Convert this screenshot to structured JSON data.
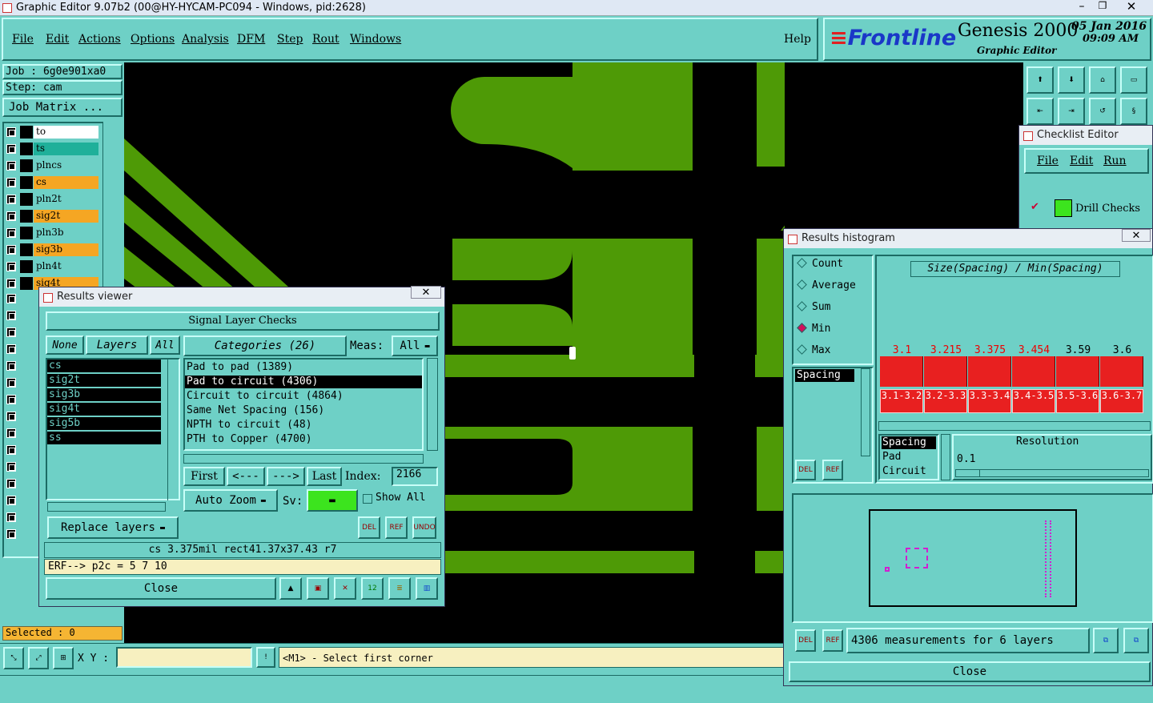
{
  "window_title": "Graphic Editor 9.07b2 (00@HY-HYCAM-PC094 - Windows, pid:2628)",
  "menu": [
    "File",
    "Edit",
    "Actions",
    "Options",
    "Analysis",
    "DFM",
    "Step",
    "Rout",
    "Windows"
  ],
  "help": "Help",
  "brand": {
    "logo": "Frontline",
    "product": "Genesis 2000",
    "sub": "Graphic Editor",
    "date": "05 Jan 2016",
    "time": "09:09 AM"
  },
  "job": {
    "job_label": "Job : 6g0e901xa0",
    "step_label": "Step: cam",
    "matrix_button": "Job Matrix ..."
  },
  "layers": [
    {
      "name": "to",
      "color": "#ffffff"
    },
    {
      "name": "ts",
      "color": "#1fb09a"
    },
    {
      "name": "plncs",
      "color": "#6ed0c6"
    },
    {
      "name": "cs",
      "color": "#f5a623"
    },
    {
      "name": "pln2t",
      "color": "#6ed0c6"
    },
    {
      "name": "sig2t",
      "color": "#f5a623"
    },
    {
      "name": "pln3b",
      "color": "#6ed0c6"
    },
    {
      "name": "sig3b",
      "color": "#f5a623"
    },
    {
      "name": "pln4t",
      "color": "#6ed0c6"
    },
    {
      "name": "sig4t",
      "color": "#f5a623"
    }
  ],
  "selected": "Selected : 0",
  "statusbar": {
    "xy_label": "X Y :",
    "xy_value": "",
    "prompt": "<M1> - Select first corner"
  },
  "results_viewer": {
    "title": "Results viewer",
    "header": "Signal Layer Checks",
    "none": "None",
    "layers": "Layers",
    "all": "All",
    "layer_list": [
      "cs",
      "sig2t",
      "sig3b",
      "sig4t",
      "sig5b",
      "ss"
    ],
    "categories_label": "Categories (26)",
    "meas_label": "Meas:",
    "meas_value": "All",
    "categories": [
      "Pad to pad (1389)",
      "Pad to circuit (4306)",
      "Circuit to circuit (4864)",
      "Same Net Spacing (156)",
      "NPTH to circuit (48)",
      "PTH to Copper (4700)"
    ],
    "selected_category_index": 1,
    "first": "First",
    "prev": "<---",
    "next": "--->",
    "last": "Last",
    "index_label": "Index:",
    "index_value": "2166",
    "auto_zoom": "Auto Zoom",
    "sv_label": "Sv:",
    "show_all": "Show All",
    "replace_layers": "Replace layers",
    "info": "cs 3.375mil  rect41.37x37.43  r7",
    "erf": "ERF--> p2c = 5 7 10",
    "close": "Close"
  },
  "checklist_editor": {
    "title": "Checklist Editor",
    "menu": [
      "File",
      "Edit",
      "Run"
    ],
    "item": "Drill Checks"
  },
  "histogram": {
    "title": "Results histogram",
    "modes": [
      "Count",
      "Average",
      "Sum",
      "Min",
      "Max"
    ],
    "selected_mode": "Min",
    "left_list": [
      "Spacing"
    ],
    "chart_title": "Size(Spacing) / Min(Spacing)",
    "legend_list": [
      "Spacing",
      "Pad",
      "Circuit"
    ],
    "resolution_label": "Resolution",
    "resolution_value": "0.1",
    "summary": "4306 measurements for 6 layers",
    "close": "Close"
  },
  "chart_data": {
    "type": "bar",
    "title": "Size(Spacing) / Min(Spacing)",
    "categories": [
      "3.1-3.2",
      "3.2-3.3",
      "3.3-3.4",
      "3.4-3.5",
      "3.5-3.6",
      "3.6-3.7"
    ],
    "top_labels": [
      "3.1",
      "3.215",
      "3.375",
      "3.454",
      "3.59",
      "3.6"
    ],
    "values": [
      1,
      1,
      1,
      1,
      1,
      1
    ],
    "highlighted": [
      true,
      true,
      true,
      true,
      false,
      false
    ]
  },
  "colors": {
    "teal": "#6ed0c6",
    "copper": "#4e9a06",
    "bar": "#e82020"
  }
}
